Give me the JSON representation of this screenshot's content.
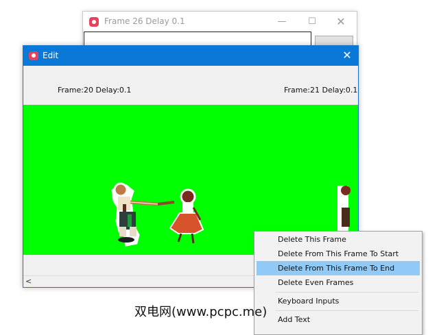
{
  "background_window": {
    "title": "Frame 26 Delay 0.1",
    "controls": {
      "minimize": "—",
      "maximize": "☐",
      "close": "✕"
    }
  },
  "edit_window": {
    "title": "Edit",
    "close": "✕",
    "frame_left": "Frame:20 Delay:0.1",
    "frame_right": "Frame:21 Delay:0.1",
    "canvas_color": "#00ff00",
    "scroll_left": "<"
  },
  "context_menu": {
    "items": [
      "Delete This Frame",
      "Delete From This Frame To Start",
      "Delete From This Frame To End",
      "Delete Even Frames",
      "Keyboard Inputs",
      "Add Text"
    ],
    "highlighted_index": 2
  },
  "watermark": "双电网(www.pcpc.me)",
  "colors": {
    "titlebar": "#0a78d7",
    "accent_icon": "#e8425a",
    "highlight": "#91c9f7"
  }
}
